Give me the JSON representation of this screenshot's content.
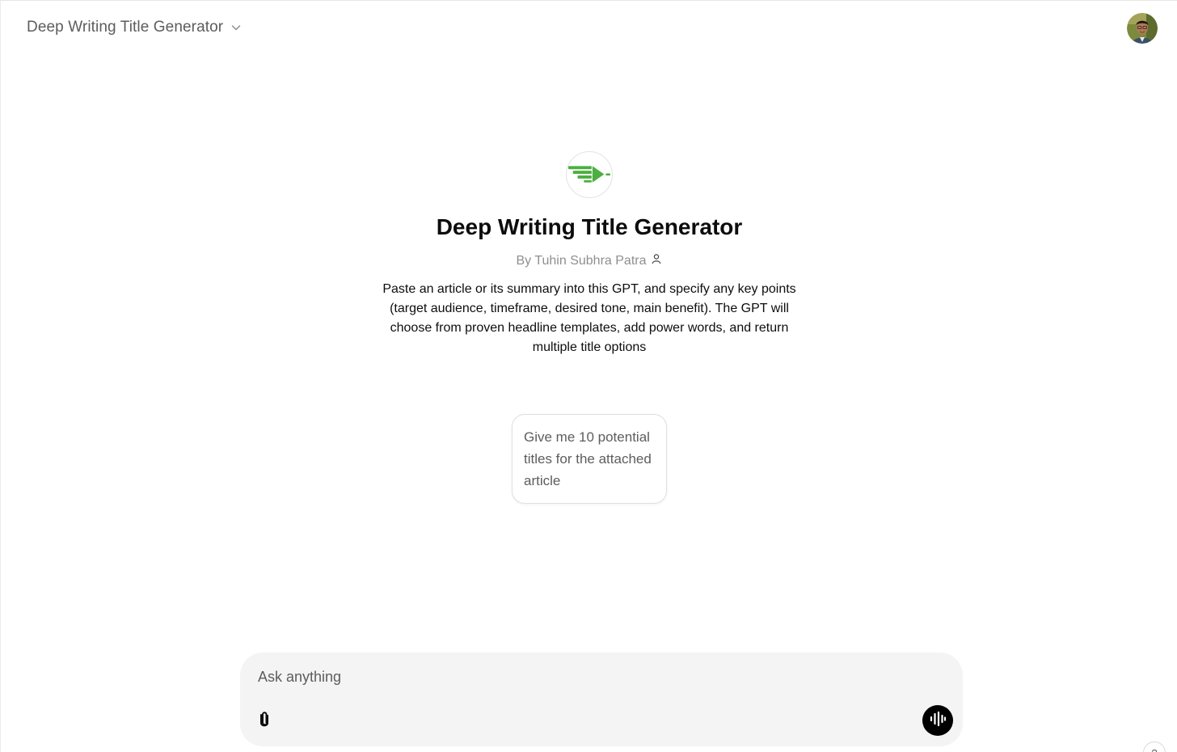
{
  "header": {
    "title": "Deep Writing Title Generator",
    "dropdown_icon": "chevron-down-icon",
    "avatar_icon": "user-avatar"
  },
  "gpt": {
    "logo_icon": "pen-nib-logo",
    "logo_color": "#4caf3f",
    "name": "Deep Writing Title Generator",
    "author": "By Tuhin Subhra Patra",
    "author_icon": "person-icon",
    "description": "Paste an article or its summary into this GPT, and specify any key points (target audience, timeframe, desired tone, main benefit). The GPT will choose from proven headline templates, add power words, and return multiple title options"
  },
  "conversation_starters": [
    {
      "label": "Give me 10 potential titles for the attached article"
    }
  ],
  "composer": {
    "placeholder": "Ask anything",
    "attach_icon": "paperclip-icon",
    "voice_icon": "voice-waveform-icon"
  },
  "help": {
    "label": "?"
  }
}
